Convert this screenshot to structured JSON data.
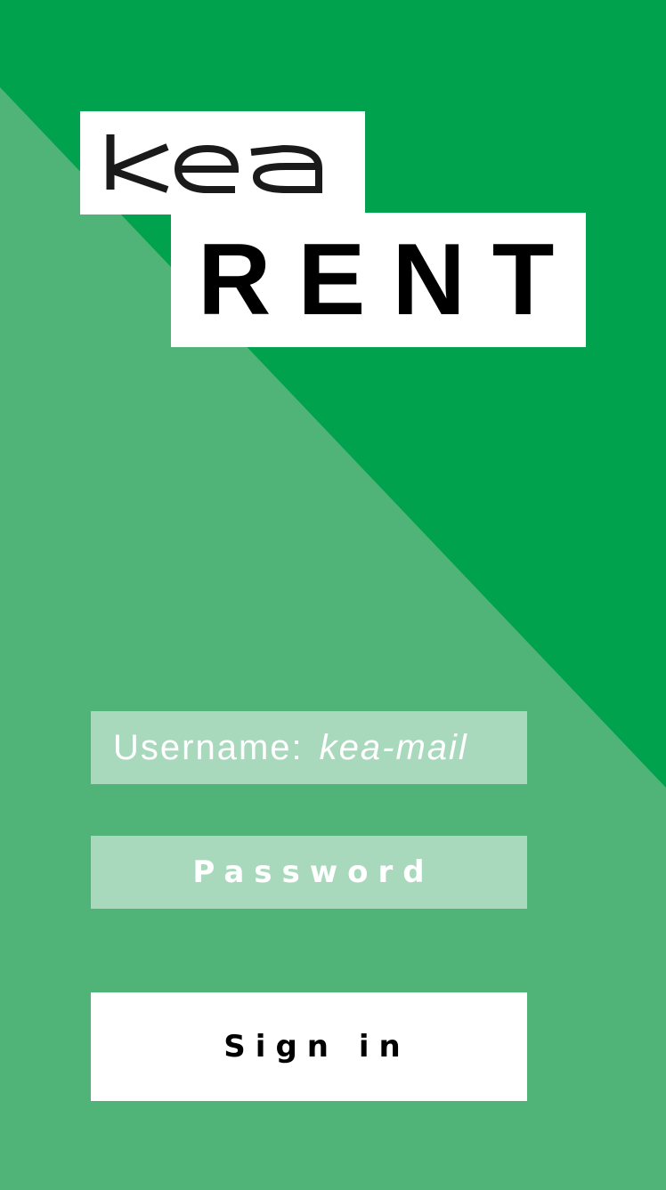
{
  "colors": {
    "dark_green": "#00a24d",
    "light_green": "#50b378",
    "input_background": "#a9d9bd",
    "white": "#ffffff",
    "black": "#000000"
  },
  "logo": {
    "kea_text": "kea",
    "rent_text": "RENT"
  },
  "login": {
    "username_label": "Username:",
    "username_hint": "kea-mail",
    "password_placeholder": "Password",
    "signin_label": "Sign in"
  }
}
